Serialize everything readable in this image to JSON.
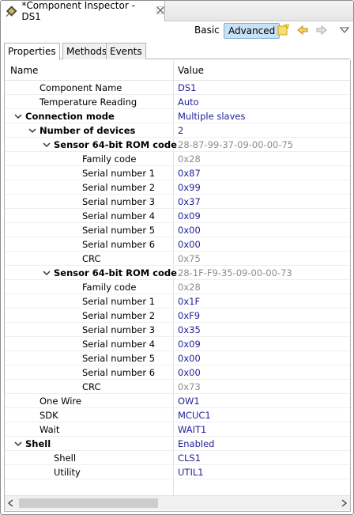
{
  "view": {
    "title": "*Component Inspector - DS1",
    "close_icon": "close-icon",
    "icon": "component-inspector-icon"
  },
  "toolbar": {
    "basic_label": "Basic",
    "advanced_label": "Advanced",
    "icons": [
      "note-icon",
      "arrow-left-icon",
      "arrow-right-icon",
      "view-menu-icon"
    ]
  },
  "tabs": [
    {
      "label": "Properties",
      "active": true
    },
    {
      "label": "Methods",
      "active": false
    },
    {
      "label": "Events",
      "active": false
    }
  ],
  "table": {
    "headers": {
      "name": "Name",
      "value": "Value"
    },
    "rows": [
      {
        "name": "Component Name",
        "value": "DS1",
        "level": 1,
        "style": "blue"
      },
      {
        "name": "Temperature Reading",
        "value": "Auto",
        "level": 1,
        "style": "blue"
      },
      {
        "name": "Connection mode",
        "value": "Multiple slaves",
        "level": 0,
        "bold": true,
        "expander": true,
        "style": "blue"
      },
      {
        "name": "Number of devices",
        "value": "2",
        "level": 1,
        "bold": true,
        "expander": true,
        "style": "blue"
      },
      {
        "name": "Sensor 64-bit ROM code",
        "value": "28-87-99-37-09-00-00-75",
        "level": 2,
        "bold": true,
        "expander": true,
        "style": "gray"
      },
      {
        "name": "Family code",
        "value": "0x28",
        "level": 4,
        "style": "gray"
      },
      {
        "name": "Serial number 1",
        "value": "0x87",
        "level": 4,
        "style": "blue"
      },
      {
        "name": "Serial number 2",
        "value": "0x99",
        "level": 4,
        "style": "blue"
      },
      {
        "name": "Serial number 3",
        "value": "0x37",
        "level": 4,
        "style": "blue"
      },
      {
        "name": "Serial number 4",
        "value": "0x09",
        "level": 4,
        "style": "blue"
      },
      {
        "name": "Serial number 5",
        "value": "0x00",
        "level": 4,
        "style": "blue"
      },
      {
        "name": "Serial number 6",
        "value": "0x00",
        "level": 4,
        "style": "blue"
      },
      {
        "name": "CRC",
        "value": "0x75",
        "level": 4,
        "style": "gray"
      },
      {
        "name": "Sensor 64-bit ROM code",
        "value": "28-1F-F9-35-09-00-00-73",
        "level": 2,
        "bold": true,
        "expander": true,
        "style": "gray"
      },
      {
        "name": "Family code",
        "value": "0x28",
        "level": 4,
        "style": "gray"
      },
      {
        "name": "Serial number 1",
        "value": "0x1F",
        "level": 4,
        "style": "blue"
      },
      {
        "name": "Serial number 2",
        "value": "0xF9",
        "level": 4,
        "style": "blue"
      },
      {
        "name": "Serial number 3",
        "value": "0x35",
        "level": 4,
        "style": "blue"
      },
      {
        "name": "Serial number 4",
        "value": "0x09",
        "level": 4,
        "style": "blue"
      },
      {
        "name": "Serial number 5",
        "value": "0x00",
        "level": 4,
        "style": "blue"
      },
      {
        "name": "Serial number 6",
        "value": "0x00",
        "level": 4,
        "style": "blue"
      },
      {
        "name": "CRC",
        "value": "0x73",
        "level": 4,
        "style": "gray"
      },
      {
        "name": "One Wire",
        "value": "OW1",
        "level": 1,
        "style": "blue"
      },
      {
        "name": "SDK",
        "value": "MCUC1",
        "level": 1,
        "style": "blue"
      },
      {
        "name": "Wait",
        "value": "WAIT1",
        "level": 1,
        "style": "blue"
      },
      {
        "name": "Shell",
        "value": "Enabled",
        "level": 0,
        "bold": true,
        "expander": true,
        "style": "blue"
      },
      {
        "name": "Shell",
        "value": "CLS1",
        "level": 2,
        "style": "blue"
      },
      {
        "name": "Utility",
        "value": "UTIL1",
        "level": 2,
        "style": "blue"
      }
    ]
  },
  "colors": {
    "value_blue": "#1f1f9a",
    "value_gray": "#8c8c8c",
    "advanced_bg": "#c9e1f5"
  }
}
